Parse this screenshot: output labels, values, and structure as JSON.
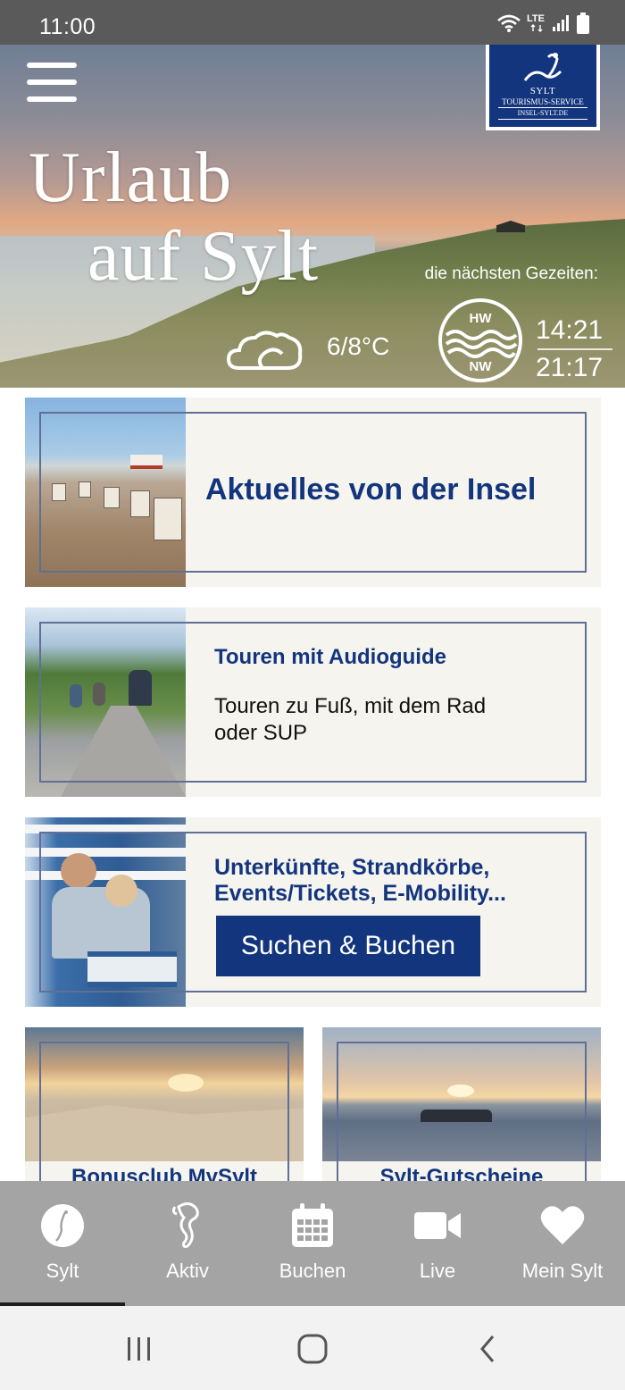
{
  "status_bar": {
    "time": "11:00",
    "network": "LTE",
    "icons": [
      "wifi-icon",
      "signal-icon",
      "battery-icon"
    ]
  },
  "hero": {
    "title_line1": "Urlaub",
    "title_line2": "auf Sylt",
    "logo": {
      "line1": "SYLT",
      "line2": "TOURISMUS-SERVICE",
      "line3": "INSEL-SYLT.DE"
    },
    "tides_caption": "die nächsten Gezeiten:",
    "weather_icon": "cloud-icon",
    "temperature": "6/8°C",
    "tide_icon": {
      "high": "HW",
      "low": "NW"
    },
    "tide_high_time": "14:21",
    "tide_low_time": "21:17"
  },
  "cards": {
    "news": {
      "title": "Aktuelles von der Insel"
    },
    "tours": {
      "title": "Touren mit Audioguide",
      "subtitle_line1": "Touren zu Fuß, mit dem Rad",
      "subtitle_line2": "oder SUP"
    },
    "booking": {
      "title_line1": "Unterkünfte, Strandkörbe,",
      "title_line2": "Events/Tickets, E-Mobility...",
      "button": "Suchen & Buchen"
    }
  },
  "tiles": [
    {
      "label": "Bonusclub MySylt"
    },
    {
      "label": "Sylt-Gutscheine"
    }
  ],
  "bottom_nav": [
    {
      "label": "Sylt",
      "icon": "sylt-logo-icon",
      "active": true
    },
    {
      "label": "Aktiv",
      "icon": "seahorse-icon",
      "active": false
    },
    {
      "label": "Buchen",
      "icon": "calendar-icon",
      "active": false
    },
    {
      "label": "Live",
      "icon": "video-camera-icon",
      "active": false
    },
    {
      "label": "Mein Sylt",
      "icon": "heart-icon",
      "active": false
    }
  ],
  "colors": {
    "brand_blue": "#13357d",
    "nav_gray": "#a4a4a4",
    "card_bg": "#f5f4ef"
  }
}
